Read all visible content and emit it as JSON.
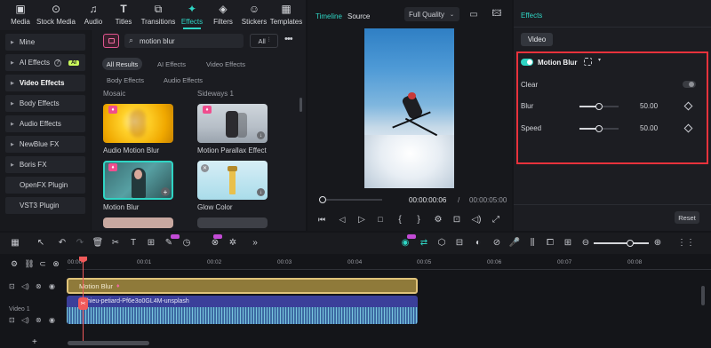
{
  "top_tabs": [
    {
      "label": "Media",
      "icon": "media-icon"
    },
    {
      "label": "Stock Media",
      "icon": "stock-media-icon"
    },
    {
      "label": "Audio",
      "icon": "audio-icon"
    },
    {
      "label": "Titles",
      "icon": "titles-icon"
    },
    {
      "label": "Transitions",
      "icon": "transitions-icon"
    },
    {
      "label": "Effects",
      "icon": "effects-icon",
      "active": true
    },
    {
      "label": "Filters",
      "icon": "filters-icon"
    },
    {
      "label": "Stickers",
      "icon": "stickers-icon"
    },
    {
      "label": "Templates",
      "icon": "templates-icon"
    }
  ],
  "sidebar": {
    "items": [
      {
        "label": "Mine"
      },
      {
        "label": "AI Effects",
        "badge": "AI"
      },
      {
        "label": "Video Effects",
        "active": true
      },
      {
        "label": "Body Effects"
      },
      {
        "label": "Audio Effects"
      },
      {
        "label": "NewBlue FX"
      },
      {
        "label": "Boris FX"
      },
      {
        "label": "OpenFX Plugin"
      },
      {
        "label": "VST3 Plugin"
      }
    ]
  },
  "search": {
    "value": "motion blur",
    "filter_label": "All"
  },
  "filter_chips": [
    "All Results",
    "AI Effects",
    "Video Effects",
    "Body Effects",
    "Audio Effects"
  ],
  "sections": {
    "left": "Mosaic",
    "right": "Sideways 1"
  },
  "effect_items": [
    "Audio Motion Blur",
    "Motion Parallax Effect In",
    "Motion Blur",
    "Glow Color"
  ],
  "player": {
    "tabs": [
      "Timeline",
      "Source"
    ],
    "quality": "Full Quality",
    "current_time": "00:00:00:06",
    "separator": "/",
    "total_time": "00:00:05:00",
    "progress": 0.03
  },
  "effects_panel": {
    "title": "Effects",
    "tab": "Video",
    "effect_name": "Motion Blur",
    "clear_label": "Clear",
    "params": [
      {
        "label": "Blur",
        "value": "50.00",
        "level": 0.5
      },
      {
        "label": "Speed",
        "value": "50.00",
        "level": 0.5
      }
    ],
    "reset_label": "Reset"
  },
  "ruler": {
    "marks": [
      "00:00",
      "00:01",
      "00:02",
      "00:03",
      "00:04",
      "00:05",
      "00:06",
      "00:07",
      "00:08"
    ]
  },
  "tracks": {
    "effect_clip": "Motion Blur",
    "video_clip": "hieu-petiard-Pf6e3o0GL4M-unsplash",
    "video_track_label": "Video 1"
  },
  "colors": {
    "accent": "#2fd5c4",
    "highlight_box": "#e8323c",
    "effect_clip": "#8f7a3a",
    "video_clip": "#3b3f9a",
    "playhead": "#f05a5a"
  }
}
